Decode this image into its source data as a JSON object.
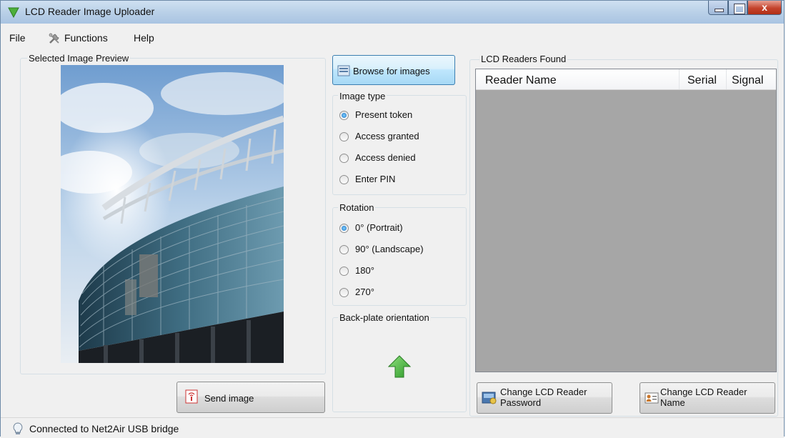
{
  "window": {
    "title": "LCD Reader Image Uploader",
    "close_glyph": "x"
  },
  "menu": {
    "file": "File",
    "functions": "Functions",
    "help": "Help"
  },
  "preview": {
    "legend": "Selected Image Preview",
    "send_button": "Send image"
  },
  "browse_button": "Browse for images",
  "image_type": {
    "legend": "Image type",
    "options": [
      "Present token",
      "Access granted",
      "Access denied",
      "Enter PIN"
    ],
    "selected": "Present token"
  },
  "rotation": {
    "legend": "Rotation",
    "options": [
      "0° (Portrait)",
      "90° (Landscape)",
      "180°",
      "270°"
    ],
    "selected": "0° (Portrait)"
  },
  "backplate": {
    "legend": "Back-plate orientation",
    "arrow": "up-arrow-icon"
  },
  "readers": {
    "legend": "LCD Readers Found",
    "columns": [
      "Reader Name",
      "Serial",
      "Signal"
    ],
    "rows": [],
    "change_password_button": [
      "Change LCD Reader",
      "Password"
    ],
    "change_name_button": [
      "Change LCD Reader",
      "Name"
    ]
  },
  "status": {
    "text": "Connected to Net2Air USB bridge"
  },
  "colors": {
    "titlebar": "#b8cfe7",
    "list_background": "#a6a6a6",
    "accent_green": "#3fae3a"
  }
}
